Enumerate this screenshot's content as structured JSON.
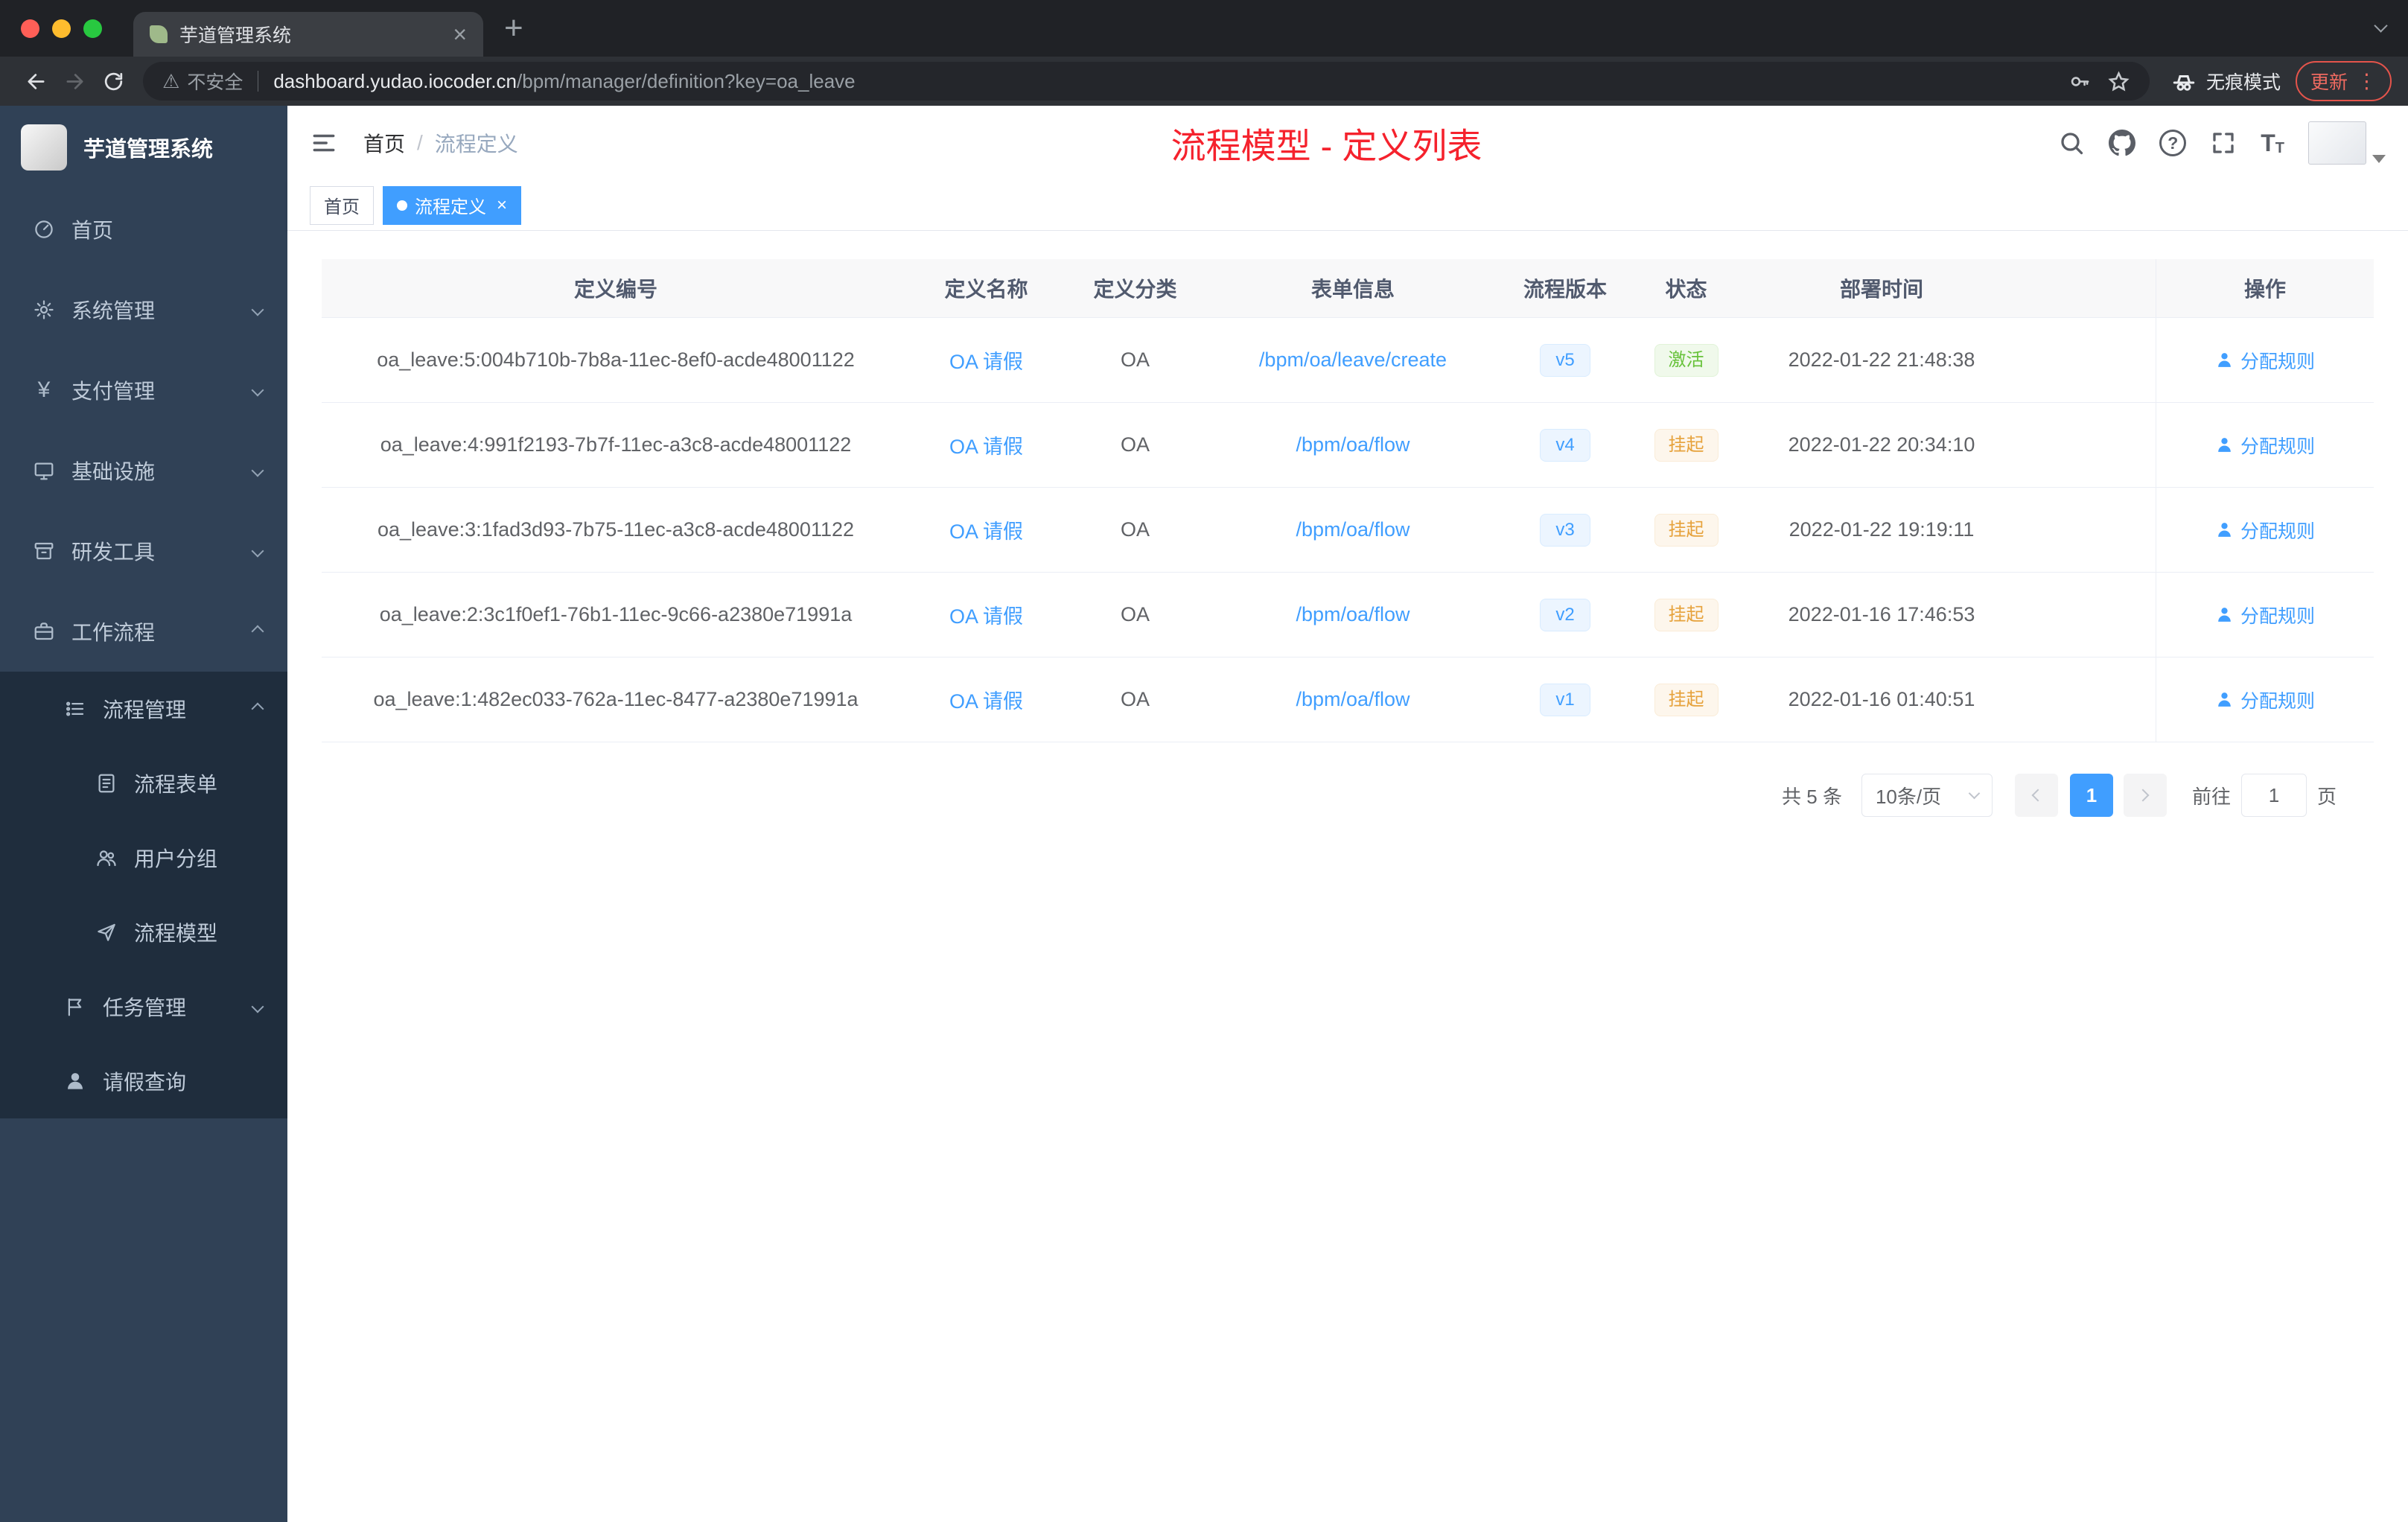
{
  "browser": {
    "tab_title": "芋道管理系统",
    "security_label": "不安全",
    "url_host": "dashboard.yudao.iocoder.cn",
    "url_path": "/bpm/manager/definition?key=oa_leave",
    "incognito_label": "无痕模式",
    "update_label": "更新"
  },
  "sidebar": {
    "logo_title": "芋道管理系统",
    "items": [
      {
        "label": "首页"
      },
      {
        "label": "系统管理"
      },
      {
        "label": "支付管理"
      },
      {
        "label": "基础设施"
      },
      {
        "label": "研发工具"
      },
      {
        "label": "工作流程"
      },
      {
        "label": "流程管理"
      },
      {
        "label": "流程表单"
      },
      {
        "label": "用户分组"
      },
      {
        "label": "流程模型"
      },
      {
        "label": "任务管理"
      },
      {
        "label": "请假查询"
      }
    ]
  },
  "header": {
    "breadcrumb_home": "首页",
    "breadcrumb_current": "流程定义",
    "page_title": "流程模型 - 定义列表"
  },
  "tags": {
    "home": "首页",
    "current": "流程定义"
  },
  "table": {
    "columns": [
      "定义编号",
      "定义名称",
      "定义分类",
      "表单信息",
      "流程版本",
      "状态",
      "部署时间",
      "操作"
    ],
    "rows": [
      {
        "id": "oa_leave:5:004b710b-7b8a-11ec-8ef0-acde48001122",
        "name": "OA 请假",
        "category": "OA",
        "form": "/bpm/oa/leave/create",
        "version": "v5",
        "status": "激活",
        "status_type": "success",
        "deploy_time": "2022-01-22 21:48:38",
        "action": "分配规则"
      },
      {
        "id": "oa_leave:4:991f2193-7b7f-11ec-a3c8-acde48001122",
        "name": "OA 请假",
        "category": "OA",
        "form": "/bpm/oa/flow",
        "version": "v4",
        "status": "挂起",
        "status_type": "warning",
        "deploy_time": "2022-01-22 20:34:10",
        "action": "分配规则"
      },
      {
        "id": "oa_leave:3:1fad3d93-7b75-11ec-a3c8-acde48001122",
        "name": "OA 请假",
        "category": "OA",
        "form": "/bpm/oa/flow",
        "version": "v3",
        "status": "挂起",
        "status_type": "warning",
        "deploy_time": "2022-01-22 19:19:11",
        "action": "分配规则"
      },
      {
        "id": "oa_leave:2:3c1f0ef1-76b1-11ec-9c66-a2380e71991a",
        "name": "OA 请假",
        "category": "OA",
        "form": "/bpm/oa/flow",
        "version": "v2",
        "status": "挂起",
        "status_type": "warning",
        "deploy_time": "2022-01-16 17:46:53",
        "action": "分配规则"
      },
      {
        "id": "oa_leave:1:482ec033-762a-11ec-8477-a2380e71991a",
        "name": "OA 请假",
        "category": "OA",
        "form": "/bpm/oa/flow",
        "version": "v1",
        "status": "挂起",
        "status_type": "warning",
        "deploy_time": "2022-01-16 01:40:51",
        "action": "分配规则"
      }
    ]
  },
  "pagination": {
    "total": "共 5 条",
    "page_size": "10条/页",
    "page": "1",
    "goto": "前往",
    "unit": "页",
    "goto_value": "1"
  },
  "colors": {
    "accent": "#409eff",
    "success": "#67c23a",
    "warning": "#e6a23c",
    "title_red": "#f5222d",
    "sidebar_bg": "#304156",
    "submenu_bg": "#1f2d3d"
  },
  "icons": [
    "leaf-favicon",
    "close-icon",
    "plus-icon",
    "chevron-down-icon",
    "back-icon",
    "forward-icon",
    "reload-icon",
    "warning-icon",
    "key-icon",
    "star-icon",
    "incognito-icon",
    "menu-dots-icon",
    "dashboard-icon",
    "gear-icon",
    "yen-icon",
    "monitor-icon",
    "toolbox-icon",
    "briefcase-icon",
    "list-icon",
    "form-icon",
    "users-icon",
    "send-icon",
    "flag-icon",
    "user-icon",
    "hamburger-icon",
    "search-icon",
    "github-icon",
    "question-icon",
    "fullscreen-icon",
    "font-size-icon"
  ]
}
